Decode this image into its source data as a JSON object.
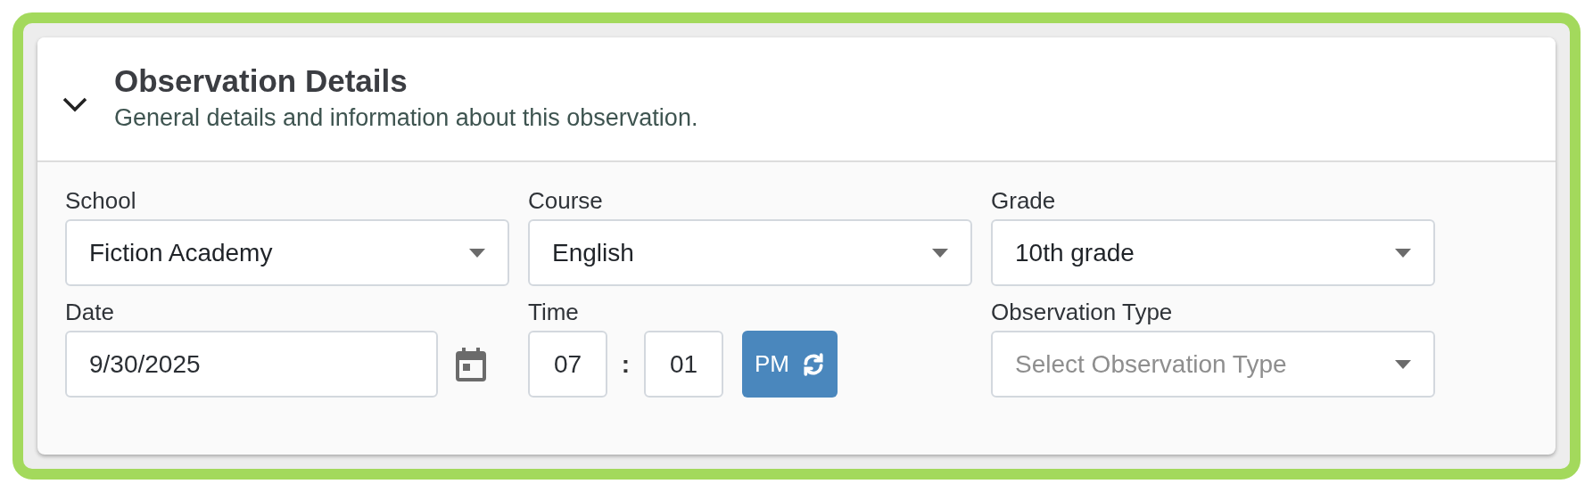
{
  "panel": {
    "title": "Observation Details",
    "subtitle": "General details and information about this observation.",
    "expanded": true
  },
  "fields": [
    {
      "kind": "select",
      "label": "School",
      "value": "Fiction Academy"
    },
    {
      "kind": "select",
      "label": "Course",
      "value": "English"
    },
    {
      "kind": "select",
      "label": "Grade",
      "value": "10th grade"
    },
    {
      "kind": "date",
      "label": "Date",
      "value": "9/30/2025"
    },
    {
      "kind": "time",
      "label": "Time",
      "hour": "07",
      "separator": ":",
      "minute": "01",
      "meridiem": "PM"
    },
    {
      "kind": "select",
      "label": "Observation Type",
      "placeholder": "Select Observation Type"
    }
  ]
}
